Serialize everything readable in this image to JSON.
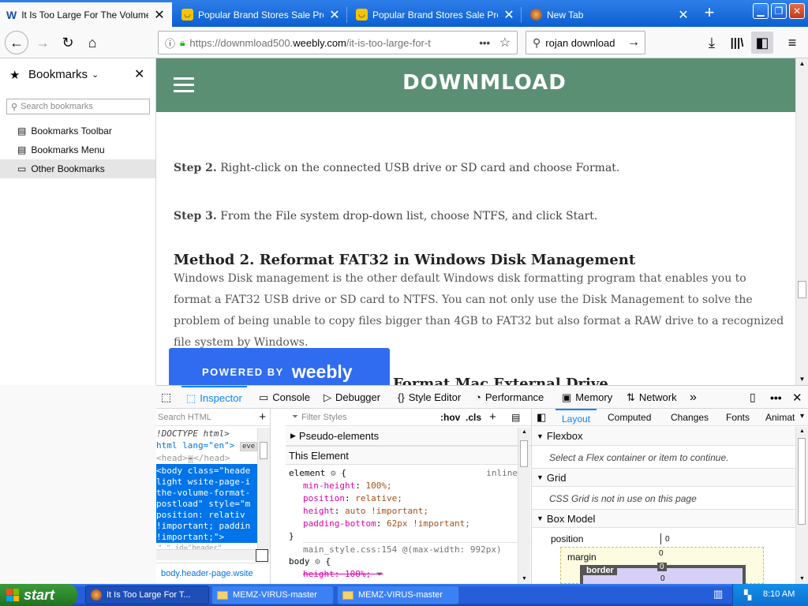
{
  "browser": {
    "tabs": [
      {
        "title": "It Is Too Large For The Volume Fo",
        "favicon": "weebly-icon",
        "active": true
      },
      {
        "title": "Popular Brand Stores Sale Promot",
        "favicon": "smiley-icon"
      },
      {
        "title": "Popular Brand Stores Sale Promot",
        "favicon": "smiley-icon"
      },
      {
        "title": "New Tab",
        "favicon": "firefox-icon"
      }
    ],
    "url_prefix": "https://downmload500.",
    "url_domain": "weebly.com",
    "url_path": "/it-is-too-large-for-t",
    "search_value": "rojan download"
  },
  "sidebar": {
    "title": "Bookmarks",
    "search_placeholder": "Search bookmarks",
    "items": [
      "Bookmarks Toolbar",
      "Bookmarks Menu",
      "Other Bookmarks"
    ]
  },
  "page": {
    "site_title": "DOWNMLOAD",
    "step2_label": "Step 2.",
    "step2_text": " Right-click on the connected USB drive or SD card and choose Format.",
    "step3_label": "Step 3.",
    "step3_text": " From the File system drop-down list, choose NTFS, and click Start.",
    "method2_title": "Method 2. Reformat FAT32 in Windows Disk Management",
    "method2_text": "Windows Disk management is the other default Windows disk formatting program that enables you to format a FAT32 USB drive or SD card to NTFS. You can not only use the Disk Management to solve the problem of being unable to copy files bigger than 4GB to FAT32 but also format a RAW drive to a recognized file system by Windows.",
    "next_heading_partial": "Format Mac External Drive",
    "weebly_powered": "POWERED BY",
    "weebly_brand": "weebly"
  },
  "devtools": {
    "tabs": [
      "Inspector",
      "Console",
      "Debugger",
      "Style Editor",
      "Performance",
      "Memory",
      "Network"
    ],
    "search_html_placeholder": "Search HTML",
    "html_lines": [
      "!DOCTYPE html>",
      "html lang=\"en\">",
      "<head>",
      "</head>"
    ],
    "html_ev": "eve",
    "selected_lines": [
      "<body class=\"heade",
      "light wsite-page-i",
      "the-volume-format-",
      "postload\" style=\"m",
      "position: relativ",
      "!important; paddin",
      "!important;\">"
    ],
    "html_next": "\"  \" id=\"header\"",
    "breadcrumb": "body.header-page.wsite",
    "filter_placeholder": "Filter Styles",
    "hov": ":hov",
    "cls": ".cls",
    "pseudo": "Pseudo-elements",
    "this_element": "This Element",
    "rule_selector": "element",
    "rule_source": "inline",
    "rule_props": [
      {
        "name": "min-height",
        "value": "100%;"
      },
      {
        "name": "position",
        "value": "relative;"
      },
      {
        "name": "height",
        "value": "auto !important;"
      },
      {
        "name": "padding-bottom",
        "value": "62px !important;"
      }
    ],
    "rule_close": "}",
    "media_line": "main_style.css:154 @(max-width: 992px)",
    "body_selector": "body",
    "body_prop": "height: 100%;",
    "layout_tabs": [
      "Layout",
      "Computed",
      "Changes",
      "Fonts",
      "Animat"
    ],
    "flexbox_title": "Flexbox",
    "flexbox_text": "Select a Flex container or item to continue.",
    "grid_title": "Grid",
    "grid_text": "CSS Grid is not in use on this page",
    "boxmodel_title": "Box Model",
    "bm_position": "position",
    "bm_position_val": "0",
    "bm_margin": "margin",
    "bm_margin_val": "0",
    "bm_border": "border",
    "bm_border_val": "0",
    "bm_inner_val": "0"
  },
  "taskbar": {
    "start": "start",
    "items": [
      "It Is Too Large For T...",
      "MEMZ-VIRUS-master",
      "MEMZ-VIRUS-master"
    ],
    "clock": "8:10 AM"
  }
}
